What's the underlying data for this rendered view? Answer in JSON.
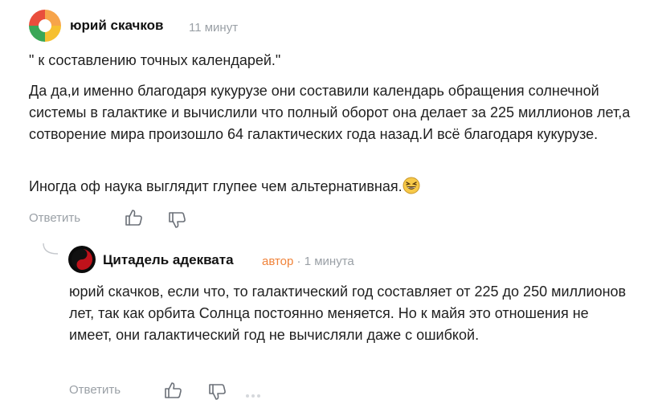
{
  "comment": {
    "author": "юрий скачков",
    "time": "11 минут",
    "paragraphs": [
      "\" к составлению точных календарей.\"",
      "Да да,и именно благодаря кукурузе они составили календарь обращения солнечной системы в галактике и вычислили что полный оборот она делает за 225 миллионов лет,а сотворение мира произошло 64 галактических года назад.И всё благодаря кукурузе.",
      "Иногда оф наука выглядит глупее чем альтернативная."
    ],
    "emoji": "grinning-squinting-face",
    "reply_label": "Ответить",
    "like_icon": "thumbs-up-icon",
    "dislike_icon": "thumbs-down-icon"
  },
  "reply": {
    "author": "Цитадель адеквата",
    "badge": "автор",
    "separator": "·",
    "time": "1 минута",
    "paragraphs": [
      "юрий скачков, если что, то галактический год составляет от 225 до 250 миллионов лет, так как орбита Солнца постоянно меняется. Но к майя это отношения не имеет, они галактический год не вычисляли даже с ошибкой."
    ],
    "reply_label": "Ответить",
    "like_icon": "thumbs-up-icon",
    "dislike_icon": "thumbs-down-icon",
    "more_icon": "ellipsis-icon"
  },
  "colors": {
    "author_badge": "#f0833a",
    "muted": "#9aa0a6",
    "text": "#1f1f1f"
  }
}
